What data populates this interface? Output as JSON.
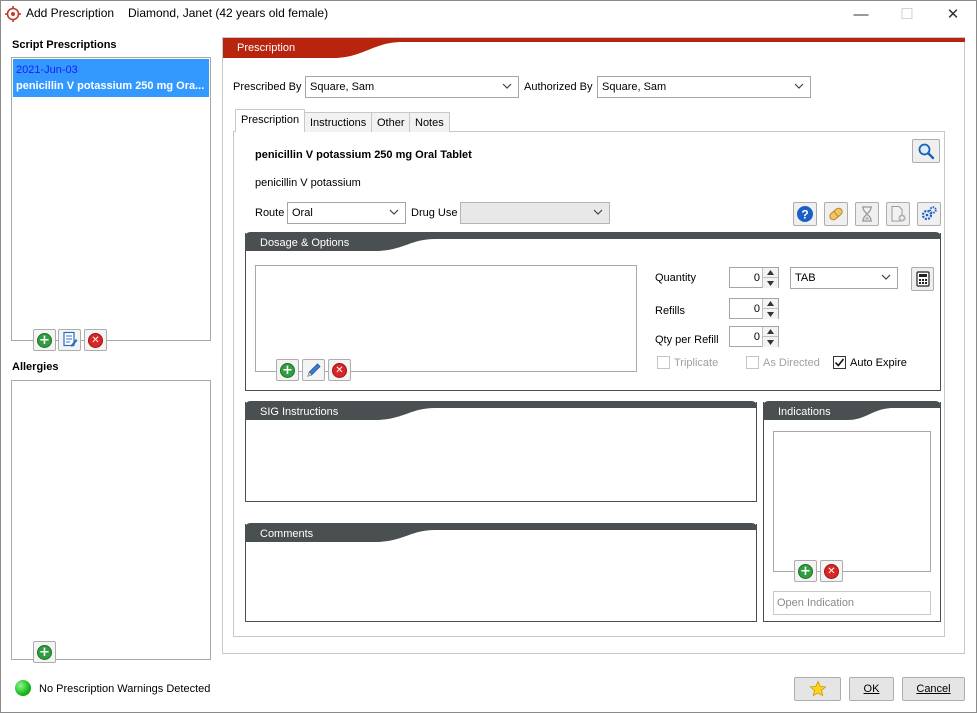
{
  "window": {
    "title": "Add Prescription",
    "patient": "Diamond, Janet (42 years old female)",
    "minimize": "—",
    "maximize": "☐",
    "close": "✕"
  },
  "left": {
    "script_prescriptions_label": "Script Prescriptions",
    "prescriptions": [
      {
        "date": "2021-Jun-03",
        "name": "penicillin V potassium 250 mg Ora..."
      }
    ],
    "allergies_label": "Allergies"
  },
  "main": {
    "header": "Prescription",
    "prescribed_by_label": "Prescribed By",
    "prescribed_by_value": "Square, Sam",
    "authorized_by_label": "Authorized By",
    "authorized_by_value": "Square, Sam",
    "tabs": [
      {
        "label": "Prescription",
        "active": true
      },
      {
        "label": "Instructions",
        "active": false
      },
      {
        "label": "Other",
        "active": false
      },
      {
        "label": "Notes",
        "active": false
      }
    ],
    "drug_title": "penicillin V potassium 250 mg Oral Tablet",
    "drug_generic": "penicillin V potassium",
    "route_label": "Route",
    "route_value": "Oral",
    "drug_use_label": "Drug Use",
    "drug_use_value": "",
    "dosage": {
      "header": "Dosage & Options",
      "quantity_label": "Quantity",
      "quantity_value": "0",
      "unit_value": "TAB",
      "refills_label": "Refills",
      "refills_value": "0",
      "qty_per_refill_label": "Qty per Refill",
      "qty_per_refill_value": "0",
      "triplicate_label": "Triplicate",
      "triplicate_checked": false,
      "as_directed_label": "As Directed",
      "as_directed_checked": false,
      "auto_expire_label": "Auto Expire",
      "auto_expire_checked": true
    },
    "sig_header": "SIG Instructions",
    "comments_header": "Comments",
    "indications_header": "Indications",
    "open_indication_placeholder": "Open Indication"
  },
  "footer": {
    "status": "No Prescription Warnings Detected",
    "status_color": "#1fbf1f",
    "ok_label": "OK",
    "cancel_label": "Cancel"
  },
  "colors": {
    "header_red": "#b8250f",
    "group_dark": "#4a4f52",
    "selection_blue": "#3399ff"
  }
}
